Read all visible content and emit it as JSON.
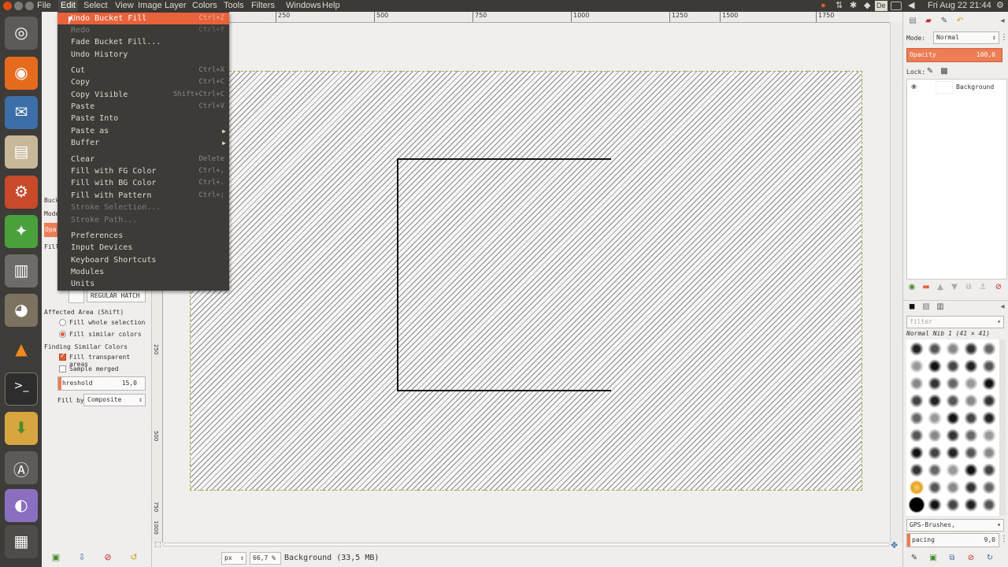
{
  "menubar": {
    "items": [
      "File",
      "Edit",
      "Select",
      "View",
      "Image",
      "Layer",
      "Colors",
      "Tools",
      "Filters",
      "Windows",
      "Help"
    ],
    "active": "Edit"
  },
  "tray": {
    "language": "De",
    "clock": "Fri Aug 22 21:44"
  },
  "edit_menu": {
    "items": [
      {
        "label": "Undo Bucket Fill",
        "shortcut": "Ctrl+Z"
      },
      {
        "label": "Redo",
        "shortcut": "Ctrl+Y"
      },
      {
        "label": "Fade Bucket Fill...",
        "shortcut": ""
      },
      {
        "label": "Undo History",
        "shortcut": ""
      },
      {
        "label": "Cut",
        "shortcut": "Ctrl+X"
      },
      {
        "label": "Copy",
        "shortcut": "Ctrl+C"
      },
      {
        "label": "Copy Visible",
        "shortcut": "Shift+Ctrl+C"
      },
      {
        "label": "Paste",
        "shortcut": "Ctrl+V"
      },
      {
        "label": "Paste Into",
        "shortcut": ""
      },
      {
        "label": "Paste as",
        "shortcut": ""
      },
      {
        "label": "Buffer",
        "shortcut": ""
      },
      {
        "label": "Clear",
        "shortcut": "Delete"
      },
      {
        "label": "Fill with FG Color",
        "shortcut": "Ctrl+,"
      },
      {
        "label": "Fill with BG Color",
        "shortcut": "Ctrl+."
      },
      {
        "label": "Fill with Pattern",
        "shortcut": "Ctrl+;"
      },
      {
        "label": "Stroke Selection...",
        "shortcut": ""
      },
      {
        "label": "Stroke Path...",
        "shortcut": ""
      },
      {
        "label": "Preferences",
        "shortcut": ""
      },
      {
        "label": "Input Devices",
        "shortcut": ""
      },
      {
        "label": "Keyboard Shortcuts",
        "shortcut": ""
      },
      {
        "label": "Modules",
        "shortcut": ""
      },
      {
        "label": "Units",
        "shortcut": ""
      }
    ]
  },
  "tool_options": {
    "pattern_name": "REGULAR HATCH",
    "affected_area_title": "Affected Area  (Shift)",
    "fill_whole": "Fill whole selection",
    "fill_similar": "Fill similar colors",
    "finding_title": "Finding Similar Colors",
    "fill_transparent": "Fill transparent areas",
    "sample_merged": "Sample merged",
    "threshold_label": "hreshold",
    "threshold_value": "15,0",
    "fill_by_label": "Fill by:",
    "fill_by_value": "Composite",
    "partial_labels": [
      "Buck",
      "Mode",
      "Opa",
      "Fill"
    ]
  },
  "ruler": {
    "h_labels": [
      "250",
      "500",
      "750",
      "1000",
      "1250",
      "1500",
      "1750"
    ],
    "v_labels": [
      "250",
      "500",
      "750",
      "1000"
    ]
  },
  "statusbar": {
    "unit": "px",
    "zoom": "66,7 %",
    "message": "Background (33,5 MB)"
  },
  "layers": {
    "mode_label": "Mode:",
    "mode_value": "Normal",
    "opacity_label": "Opacity",
    "opacity_value": "100,0",
    "lock_label": "Lock:",
    "layer_name": "Background"
  },
  "brushes": {
    "filter_placeholder": "filter",
    "brush_name": "Normal Nib 1 (41 × 41)",
    "tag_value": "GPS-Brushes,",
    "spacing_label": "pacing",
    "spacing_value": "9,0"
  },
  "colors": {
    "accent": "#e8623c",
    "menu_bg": "#3c3b37",
    "panel_bg": "#3b3a36"
  }
}
